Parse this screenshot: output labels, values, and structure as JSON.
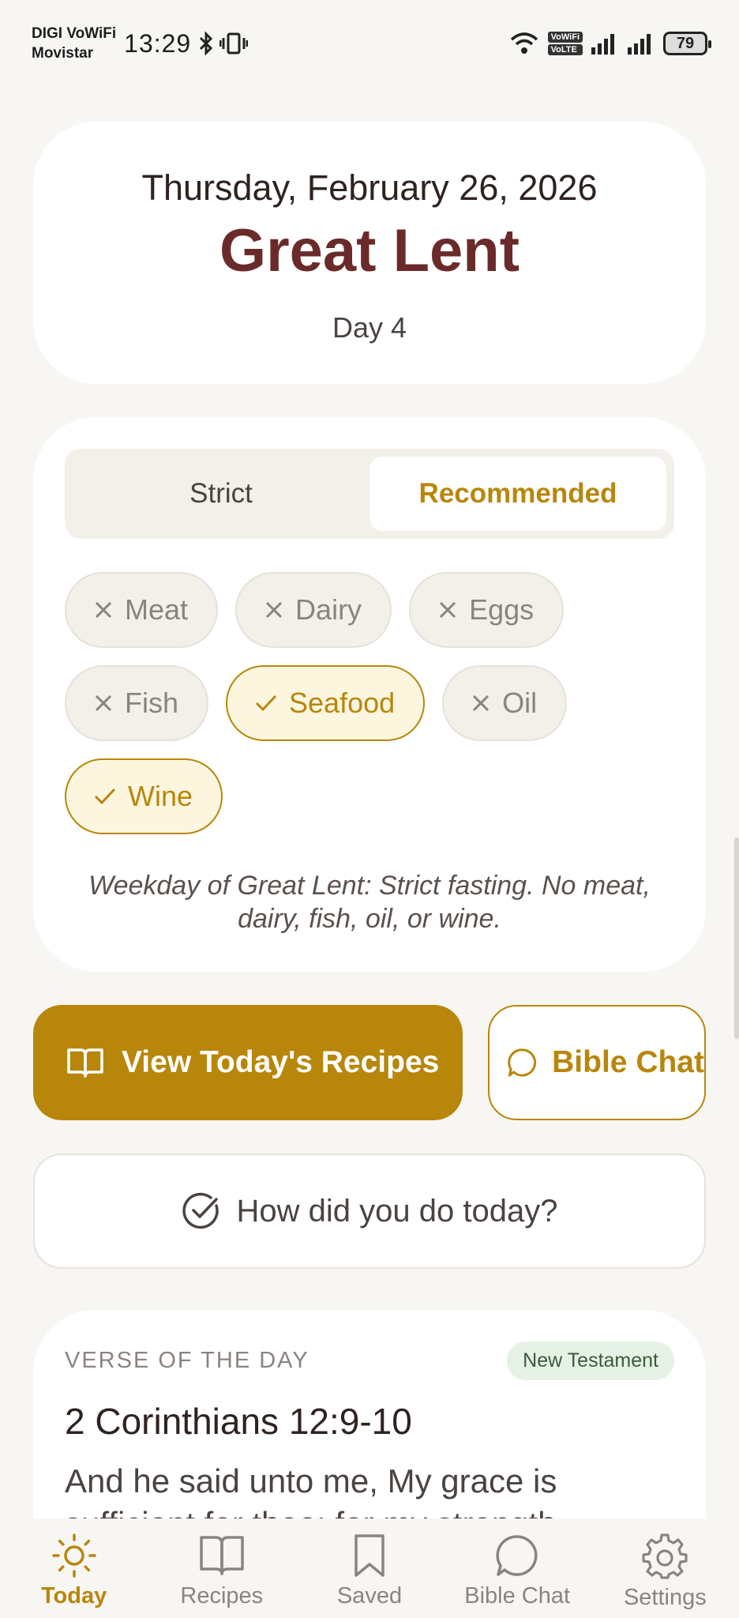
{
  "status_bar": {
    "carrier_1": "DIGI VoWiFi",
    "carrier_2": "Movistar",
    "time": "13:29",
    "battery": "79",
    "vowifi_badge": "VoWiFi",
    "volte_badge": "VoLTE"
  },
  "date_card": {
    "date": "Thursday, February 26, 2026",
    "season": "Great Lent",
    "day": "Day 4"
  },
  "fasting": {
    "modes": [
      {
        "label": "Strict",
        "active": false
      },
      {
        "label": "Recommended",
        "active": true
      }
    ],
    "foods": [
      {
        "label": "Meat",
        "allowed": false
      },
      {
        "label": "Dairy",
        "allowed": false
      },
      {
        "label": "Eggs",
        "allowed": false
      },
      {
        "label": "Fish",
        "allowed": false
      },
      {
        "label": "Seafood",
        "allowed": true
      },
      {
        "label": "Oil",
        "allowed": false
      },
      {
        "label": "Wine",
        "allowed": true
      }
    ],
    "note": "Weekday of Great Lent: Strict fasting. No meat, dairy, fish, oil, or wine."
  },
  "actions": {
    "recipes_label": "View Today's Recipes",
    "chat_label": "Bible Chat",
    "checkin_label": "How did you do today?"
  },
  "verse": {
    "section_label": "VERSE OF THE DAY",
    "badge": "New Testament",
    "reference": "2 Corinthians 12:9-10",
    "text": "And he said unto me, My grace is sufficient for thee: for my strength"
  },
  "nav": {
    "items": [
      {
        "label": "Today",
        "icon": "sun-icon",
        "active": true
      },
      {
        "label": "Recipes",
        "icon": "book-icon",
        "active": false
      },
      {
        "label": "Saved",
        "icon": "bookmark-icon",
        "active": false
      },
      {
        "label": "Bible Chat",
        "icon": "chat-bubble-icon",
        "active": false
      },
      {
        "label": "Settings",
        "icon": "gear-icon",
        "active": false
      }
    ]
  },
  "colors": {
    "accent": "#b8860b",
    "title": "#6b2a2a",
    "background": "#f8f6f3"
  }
}
